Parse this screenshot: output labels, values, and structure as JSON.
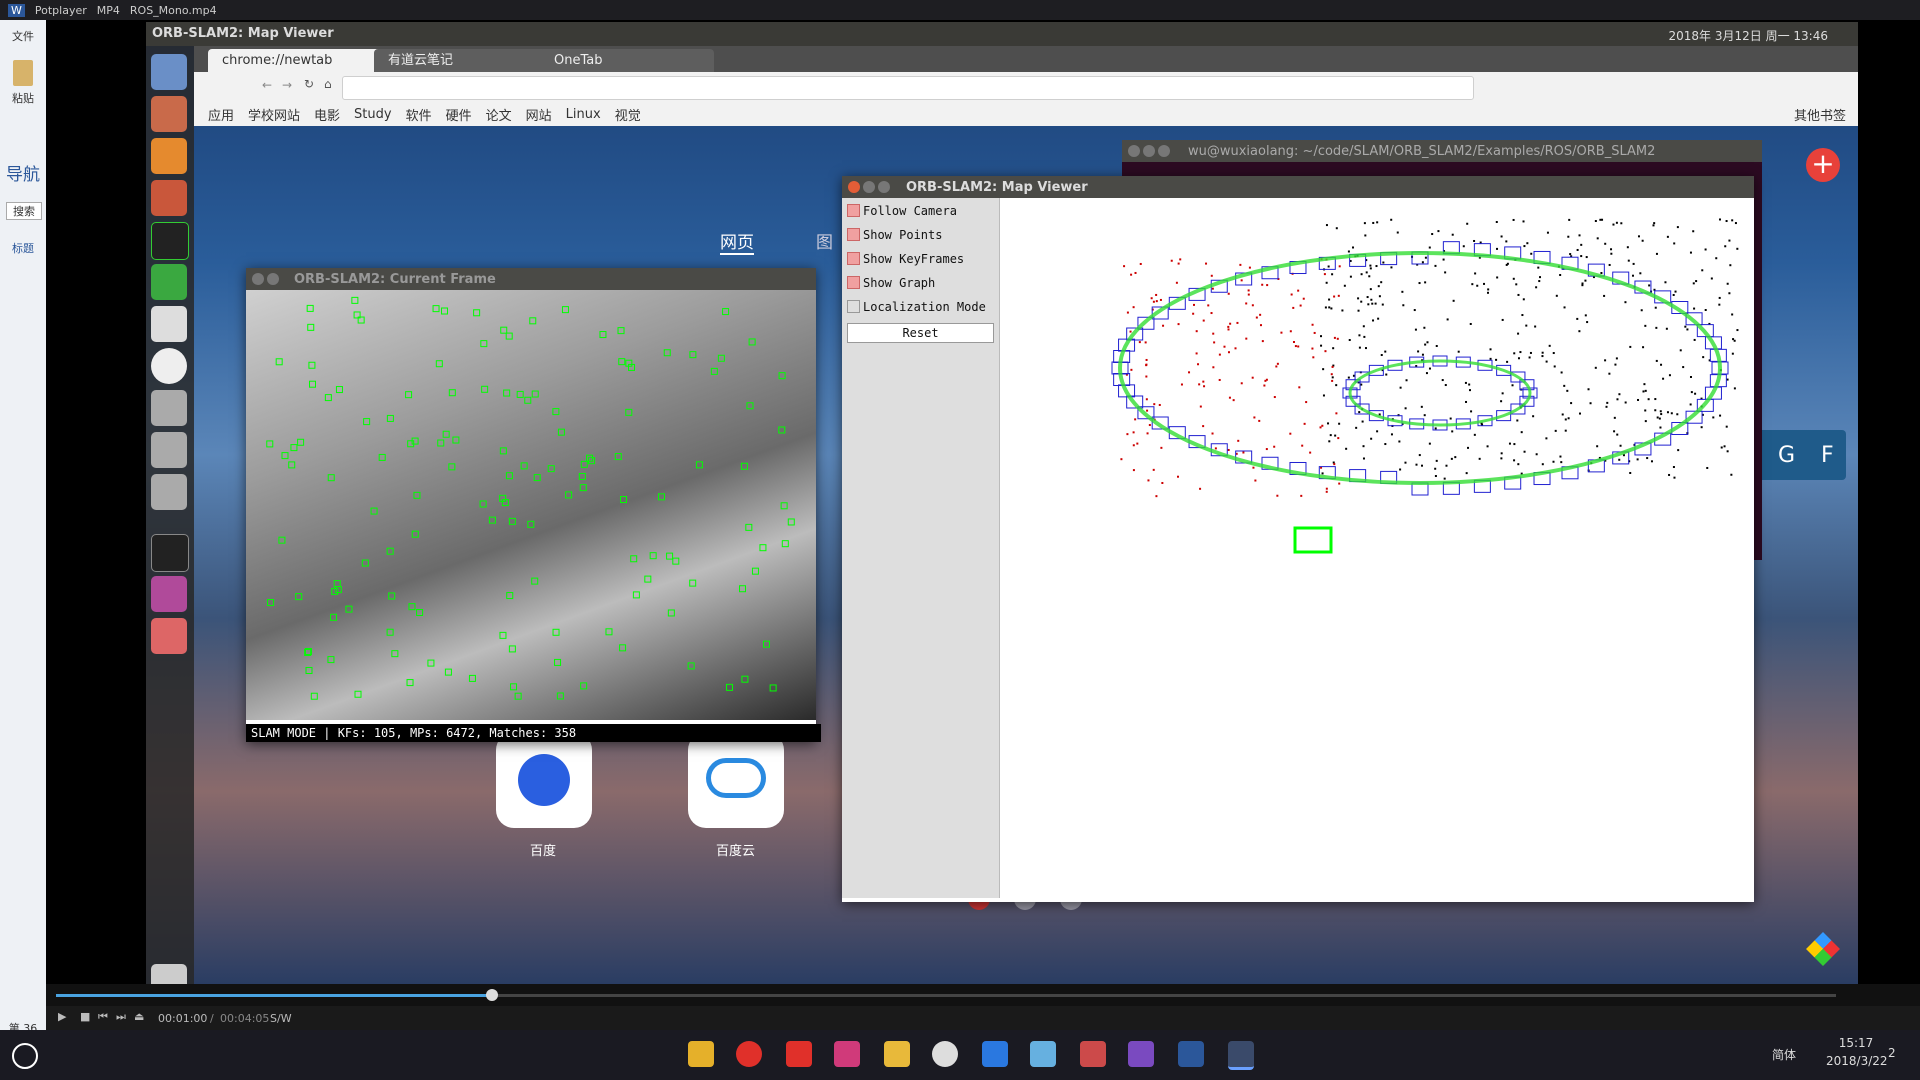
{
  "potplayer": {
    "app": "Potplayer",
    "format": "MP4",
    "file": "ROS_Mono.mp4",
    "time_current": "00:01:00",
    "time_total": "00:04:05",
    "mode": "S/W",
    "progress": 0.245
  },
  "word": {
    "menu": "文件",
    "paste": "粘贴",
    "nav": "导航",
    "search": "搜索",
    "heading": "标题",
    "page": "第 36"
  },
  "ubuntu": {
    "title": "ORB-SLAM2: Map Viewer",
    "clock": "2018年 3月12日 周一 13:46"
  },
  "chrome": {
    "tabs": [
      {
        "label": "chrome://newtab"
      },
      {
        "label": "有道云笔记"
      },
      {
        "label": "OneTab"
      }
    ],
    "bookmarks": [
      "应用",
      "学校网站",
      "电影",
      "Study",
      "软件",
      "硬件",
      "论文",
      "网站",
      "Linux",
      "视觉"
    ],
    "other_bookmarks": "其他书签",
    "newtab": {
      "tab_web": "网页",
      "tab_img": "图",
      "baidu": "百度",
      "baidu_cloud": "百度云"
    }
  },
  "current_frame": {
    "title": "ORB-SLAM2: Current Frame",
    "status": "SLAM MODE |  KFs: 105, MPs: 6472, Matches: 358"
  },
  "map_viewer": {
    "title": "ORB-SLAM2: Map Viewer",
    "options": [
      {
        "label": "Follow Camera",
        "checked": true
      },
      {
        "label": "Show Points",
        "checked": true
      },
      {
        "label": "Show KeyFrames",
        "checked": true
      },
      {
        "label": "Show Graph",
        "checked": true
      },
      {
        "label": "Localization Mode",
        "checked": false
      }
    ],
    "reset": "Reset"
  },
  "terminal": {
    "title": "wu@wuxiaolang: ~/code/SLAM/ORB_SLAM2/Examples/ROS/ORB_SLAM2"
  },
  "side_letters": [
    "G",
    "F"
  ],
  "taskbar": {
    "ime": "简体",
    "time": "15:17",
    "date": "2018/3/22",
    "notif": "2"
  },
  "colors": {
    "keypoint": "#00ff00",
    "keyframe": "#2020d0",
    "graph": "#33dd33",
    "mappoint": "#000000",
    "local_point": "#cc0000"
  }
}
